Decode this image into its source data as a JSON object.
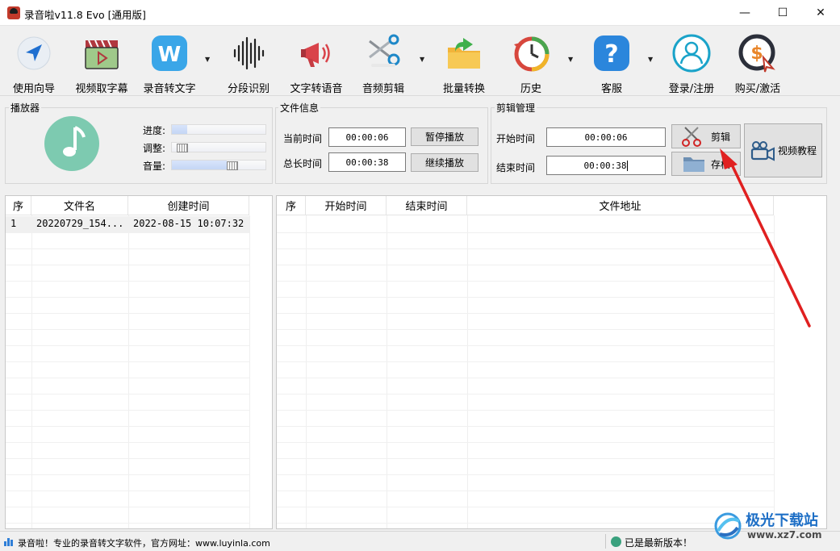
{
  "window": {
    "title": "录音啦v11.8 Evo [通用版]",
    "minimize_glyph": "—",
    "maximize_glyph": "☐",
    "close_glyph": "✕"
  },
  "toolbar": {
    "items": [
      {
        "label": "使用向导",
        "icon": "navigation-arrow-icon"
      },
      {
        "label": "视频取字幕",
        "icon": "video-clapper-icon"
      },
      {
        "label": "录音转文字",
        "icon": "w-app-icon",
        "dropdown": true
      },
      {
        "label": "分段识别",
        "icon": "waveform-icon"
      },
      {
        "label": "文字转语音",
        "icon": "megaphone-icon"
      },
      {
        "label": "音频剪辑",
        "icon": "scissors-icon",
        "dropdown": true
      },
      {
        "label": "批量转换",
        "icon": "folder-arrow-icon"
      },
      {
        "label": "历史",
        "icon": "history-clock-icon",
        "dropdown": true
      },
      {
        "label": "客服",
        "icon": "question-icon",
        "dropdown": true
      },
      {
        "label": "登录/注册",
        "icon": "user-icon"
      },
      {
        "label": "购买/激活",
        "icon": "purchase-icon"
      }
    ]
  },
  "player": {
    "title": "播放器",
    "progress_label": "进度:",
    "adjust_label": "调整:",
    "volume_label": "音量:",
    "progress": 0.16,
    "adjust": 0.05,
    "volume": 0.58
  },
  "file_info": {
    "title": "文件信息",
    "current_label": "当前时间",
    "current_value": "00:00:06",
    "total_label": "总长时间",
    "total_value": "00:00:38",
    "pause_button": "暂停播放",
    "resume_button": "继续播放"
  },
  "clip": {
    "title": "剪辑管理",
    "start_label": "开始时间",
    "start_value": "00:00:06",
    "end_label": "结束时间",
    "end_value": "00:00:38",
    "cut_button": "剪辑",
    "save_button": "存档",
    "video_tutorial": "视频教程"
  },
  "left_table": {
    "columns": [
      "序",
      "文件名",
      "创建时间"
    ],
    "rows": [
      [
        "1",
        "20220729_154...",
        "2022-08-15 10:07:32"
      ]
    ]
  },
  "right_table": {
    "columns": [
      "序",
      "开始时间",
      "结束时间",
      "文件地址"
    ],
    "rows": []
  },
  "status": {
    "left_text": "录音啦！专业的录音转文字软件，官方网址：www.luyinla.com",
    "right_text": "已是最新版本！"
  },
  "watermark": {
    "text_cn": "极光下载站",
    "url": "www.xz7.com"
  },
  "colors": {
    "annotation_arrow": "#e02020",
    "accent_blue": "#2f7fd8"
  }
}
